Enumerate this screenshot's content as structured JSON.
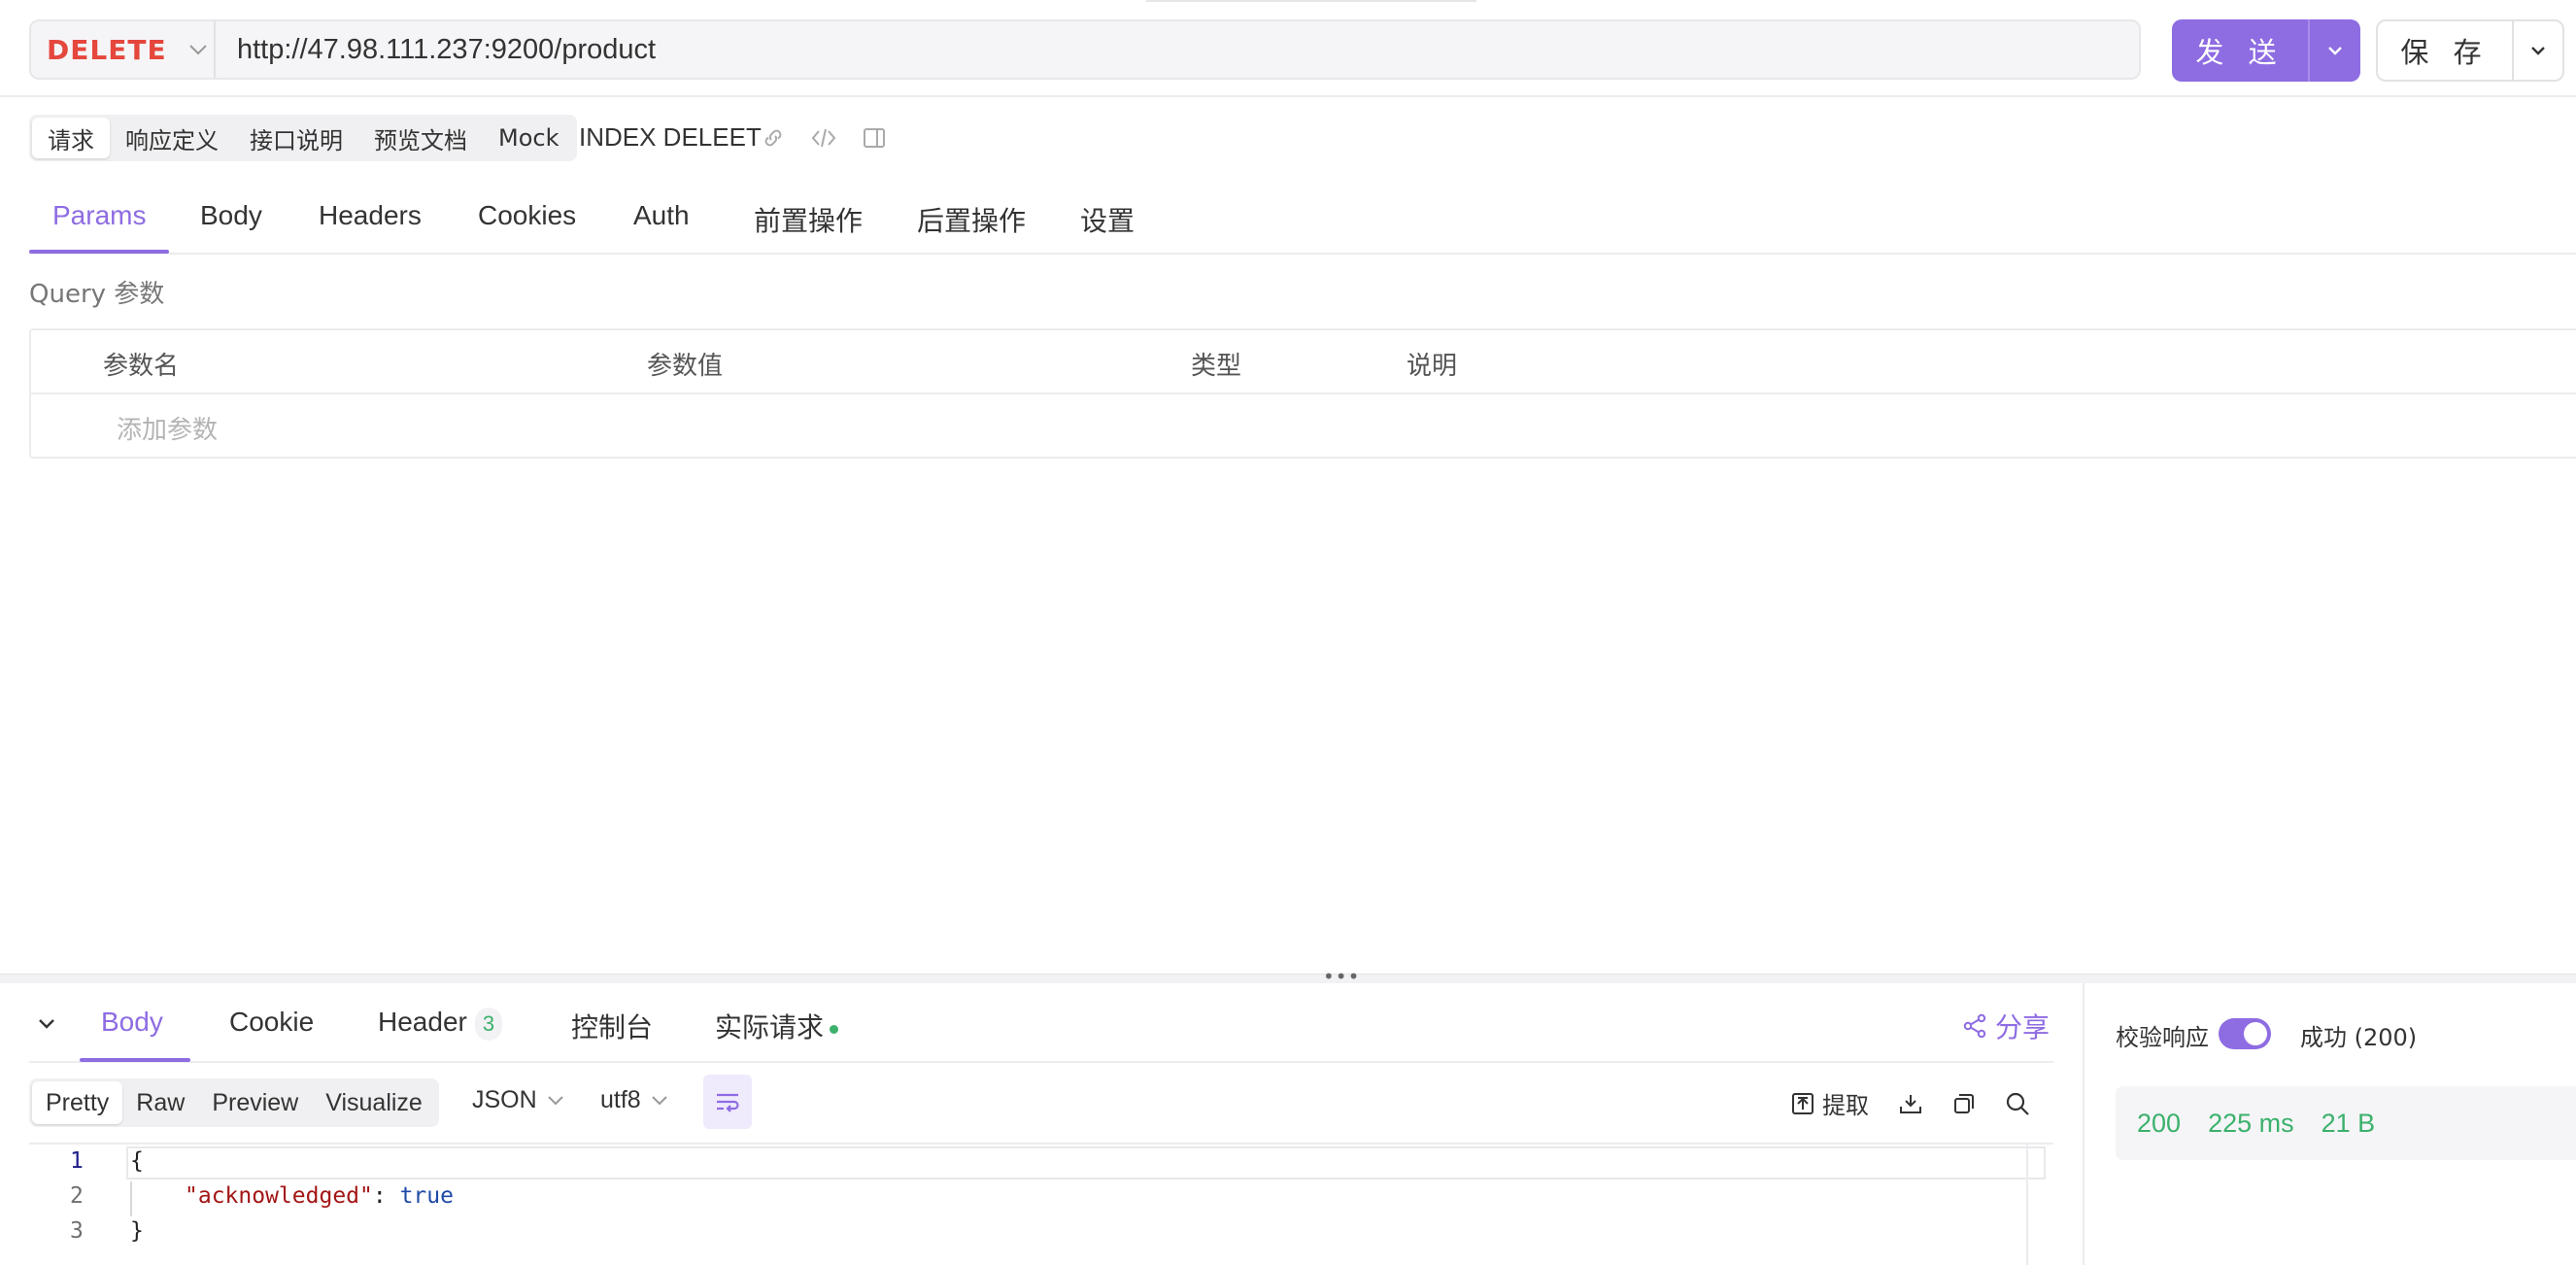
{
  "request": {
    "method": "DELETE",
    "url": "http://47.98.111.237:9200/product",
    "send_label": "发 送",
    "save_label": "保 存"
  },
  "mode_tabs": [
    "请求",
    "响应定义",
    "接口说明",
    "预览文档",
    "Mock"
  ],
  "api_name": "INDEX DELEET",
  "request_tabs": [
    "Params",
    "Body",
    "Headers",
    "Cookies",
    "Auth",
    "前置操作",
    "后置操作",
    "设置"
  ],
  "query": {
    "label": "Query 参数",
    "columns": [
      "参数名",
      "参数值",
      "类型",
      "说明"
    ],
    "add_placeholder": "添加参数"
  },
  "response": {
    "tabs": [
      "Body",
      "Cookie",
      "Header",
      "控制台",
      "实际请求"
    ],
    "header_count": "3",
    "share_label": "分享",
    "view_tabs": [
      "Pretty",
      "Raw",
      "Preview",
      "Visualize"
    ],
    "format": "JSON",
    "encoding": "utf8",
    "extract_label": "提取",
    "line_numbers": [
      "1",
      "2",
      "3"
    ],
    "code": {
      "open": "{",
      "key": "\"acknowledged\"",
      "sep": ": ",
      "value": "true",
      "close": "}"
    }
  },
  "verify": {
    "label": "校验响应",
    "status": "成功 (200)"
  },
  "stats": {
    "status_code": "200",
    "time": "225 ms",
    "size": "21 B"
  },
  "colors": {
    "accent": "#8e6ce2",
    "method": "#e5473d",
    "success": "#3bb16b"
  }
}
